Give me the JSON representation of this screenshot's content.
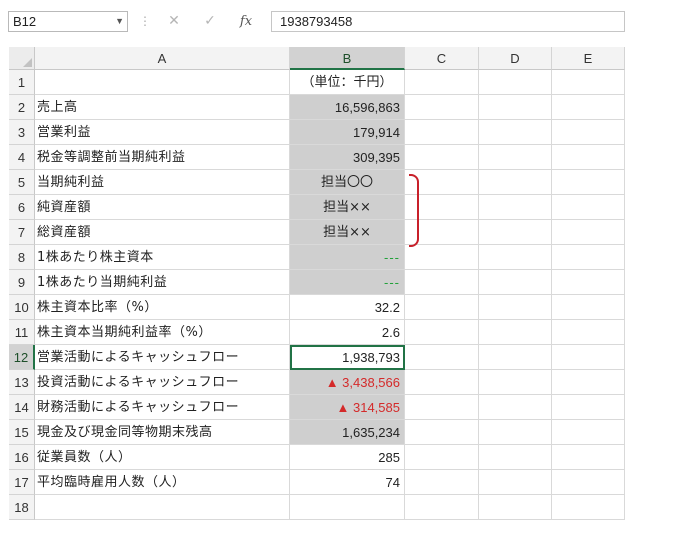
{
  "formula_bar": {
    "name_box": "B12",
    "formula_value": "1938793458",
    "fx_label": "fx"
  },
  "columns": [
    "A",
    "B",
    "C",
    "D",
    "E"
  ],
  "rows": [
    {
      "num": "1",
      "a": "",
      "b": "（単位：千円）",
      "style": "center"
    },
    {
      "num": "2",
      "a": "売上高",
      "b": "16,596,863",
      "style": "shaded"
    },
    {
      "num": "3",
      "a": "営業利益",
      "b": "179,914",
      "style": "shaded"
    },
    {
      "num": "4",
      "a": "税金等調整前当期純利益",
      "b": "309,395",
      "style": "shaded"
    },
    {
      "num": "5",
      "a": "当期純利益",
      "b": "担当〇〇",
      "style": "shaded-center"
    },
    {
      "num": "6",
      "a": "純資産額",
      "b": "担当××",
      "style": "shaded-center"
    },
    {
      "num": "7",
      "a": "総資産額",
      "b": "担当××",
      "style": "shaded-center"
    },
    {
      "num": "8",
      "a": "1株あたり株主資本",
      "b": "---",
      "style": "shaded-green"
    },
    {
      "num": "9",
      "a": "1株あたり当期純利益",
      "b": "---",
      "style": "shaded-green"
    },
    {
      "num": "10",
      "a": "株主資本比率（%）",
      "b": "32.2",
      "style": "plain"
    },
    {
      "num": "11",
      "a": "株主資本当期純利益率（%）",
      "b": "2.6",
      "style": "plain"
    },
    {
      "num": "12",
      "a": "営業活動によるキャッシュフロー",
      "b": "1,938,793",
      "style": "active"
    },
    {
      "num": "13",
      "a": "投資活動によるキャッシュフロー",
      "b": "▲ 3,438,566",
      "style": "shaded-red"
    },
    {
      "num": "14",
      "a": "財務活動によるキャッシュフロー",
      "b": "▲ 314,585",
      "style": "shaded-red"
    },
    {
      "num": "15",
      "a": "現金及び現金同等物期末残高",
      "b": "1,635,234",
      "style": "shaded"
    },
    {
      "num": "16",
      "a": "従業員数（人）",
      "b": "285",
      "style": "plain"
    },
    {
      "num": "17",
      "a": "平均臨時雇用人数（人）",
      "b": "74",
      "style": "plain"
    },
    {
      "num": "18",
      "a": "",
      "b": "",
      "style": "plain"
    }
  ],
  "colors": {
    "accent": "#217346",
    "negative": "#d42a2a",
    "dash": "#22a13a",
    "bracket": "#c8202a",
    "shade": "#cfcfcf"
  }
}
